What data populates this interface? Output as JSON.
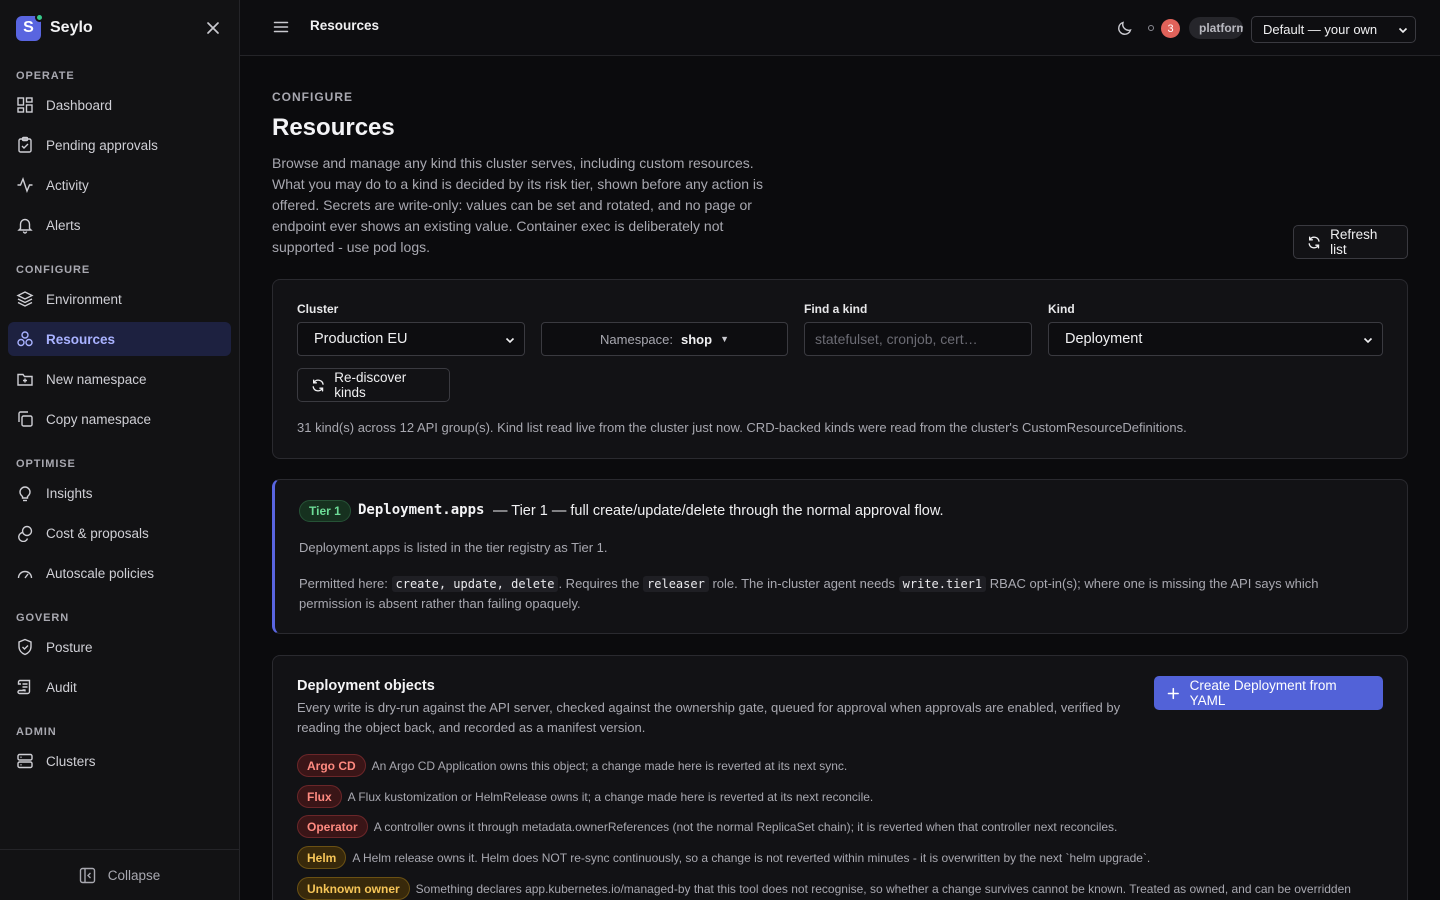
{
  "app": {
    "name": "Seylo"
  },
  "sidebar": {
    "sections": [
      {
        "label": "OPERATE",
        "items": [
          {
            "label": "Dashboard"
          },
          {
            "label": "Pending approvals"
          },
          {
            "label": "Activity"
          },
          {
            "label": "Alerts"
          }
        ]
      },
      {
        "label": "CONFIGURE",
        "items": [
          {
            "label": "Environment"
          },
          {
            "label": "Resources",
            "active": true
          },
          {
            "label": "New namespace"
          },
          {
            "label": "Copy namespace"
          }
        ]
      },
      {
        "label": "OPTIMISE",
        "items": [
          {
            "label": "Insights"
          },
          {
            "label": "Cost & proposals"
          },
          {
            "label": "Autoscale policies"
          }
        ]
      },
      {
        "label": "GOVERN",
        "items": [
          {
            "label": "Posture"
          },
          {
            "label": "Audit"
          }
        ]
      },
      {
        "label": "ADMIN",
        "items": [
          {
            "label": "Clusters"
          }
        ]
      }
    ],
    "collapse_label": "Collapse"
  },
  "topbar": {
    "title": "Resources",
    "notifications": "3",
    "role": "platform",
    "scope": "Default — your own"
  },
  "page": {
    "overline": "CONFIGURE",
    "title": "Resources",
    "description": "Browse and manage any kind this cluster serves, including custom resources. What you may do to a kind is decided by its risk tier, shown before any action is offered. Secrets are write-only: values can be set and rotated, and no page or endpoint ever shows an existing value. Container exec is deliberately not supported - use pod logs.",
    "refresh_label": "Refresh list"
  },
  "filters": {
    "cluster_label": "Cluster",
    "cluster_value": "Production EU",
    "namespace_label": "Namespace:",
    "namespace_value": "shop",
    "find_label": "Find a kind",
    "find_placeholder": "statefulset, cronjob, cert…",
    "kind_label": "Kind",
    "kind_value": "Deployment",
    "rediscover_label": "Re-discover kinds",
    "summary": "31 kind(s) across 12 API group(s). Kind list read live from the cluster just now. CRD-backed kinds were read from the cluster's CustomResourceDefinitions."
  },
  "tier": {
    "chip": "Tier 1",
    "kind": "Deployment.apps",
    "headline": "— Tier 1 — full create/update/delete through the normal approval flow.",
    "registry_note": "Deployment.apps is listed in the tier registry as Tier 1.",
    "permitted_prefix": "Permitted here:",
    "permitted_verbs": "create, update, delete",
    "requires_prefix": ". Requires the",
    "role": "releaser",
    "agent_prefix": "role. The in-cluster agent needs",
    "agent_perm": "write.tier1",
    "agent_suffix": "RBAC opt-in(s); where one is missing the API says which permission is absent rather than failing opaquely."
  },
  "objects": {
    "title": "Deployment objects",
    "description": "Every write is dry-run against the API server, checked against the ownership gate, queued for approval when approvals are enabled, verified by reading the object back, and recorded as a manifest version.",
    "create_label": "Create Deployment from YAML",
    "owners": [
      {
        "label": "Argo CD",
        "text": "An Argo CD Application owns this object; a change made here is reverted at its next sync.",
        "color": "#ff8a80"
      },
      {
        "label": "Flux",
        "text": "A Flux kustomization or HelmRelease owns it; a change made here is reverted at its next reconcile.",
        "color": "#ff8a80"
      },
      {
        "label": "Operator",
        "text": "A controller owns it through metadata.ownerReferences (not the normal ReplicaSet chain); it is reverted when that controller next reconciles.",
        "color": "#ff8a80"
      },
      {
        "label": "Helm",
        "text": "A Helm release owns it. Helm does NOT re-sync continuously, so a change is not reverted within minutes - it is overwritten by the next `helm upgrade`.",
        "color": "#f6c558"
      },
      {
        "label": "Unknown owner",
        "text": "Something declares app.kubernetes.io/managed-by that this tool does not recognise, so whether a change survives cannot be known. Treated as owned, and can be overridden",
        "color": "#f6c558"
      }
    ]
  },
  "colors": {
    "accent": "#5965e0",
    "primary_button": "#5262d8",
    "tier_green": "#6ddc97",
    "danger": "#e0625a"
  }
}
